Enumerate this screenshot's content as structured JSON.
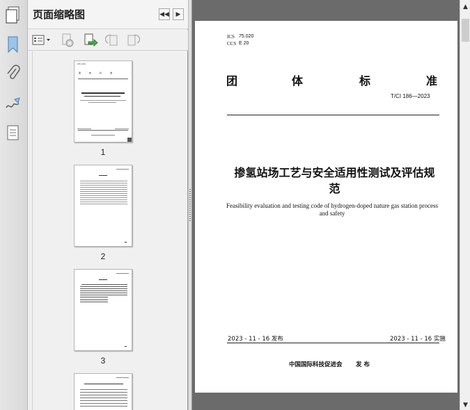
{
  "panel": {
    "title": "页面缩略图",
    "thumbnails": [
      {
        "page_label": "1"
      },
      {
        "page_label": "2"
      },
      {
        "page_label": "3"
      }
    ]
  },
  "left_strip": {
    "icons": [
      "pages-icon",
      "bookmark-icon",
      "attachment-icon",
      "signature-icon",
      "layers-icon"
    ]
  },
  "document": {
    "ics_label": "ICS",
    "ics_value": "75.020",
    "ccs_label": "CCS",
    "ccs_value": "E 20",
    "standard_type": [
      "团",
      "体",
      "标",
      "准"
    ],
    "standard_code": "T/CI 186—2023",
    "title_cn_line1": "掺氢站场工艺与安全适用性测试及评估规",
    "title_cn_line2": "范",
    "title_en_line1": "Feasibility evaluation and testing code of hydrogen-doped nature gas station process",
    "title_en_line2": "and safety",
    "publish_date": "2023 - 11 - 16 发布",
    "implement_date": "2023 - 11 - 16 实施",
    "publisher": "中国国际科技促进会",
    "publisher_suffix": "发  布"
  }
}
